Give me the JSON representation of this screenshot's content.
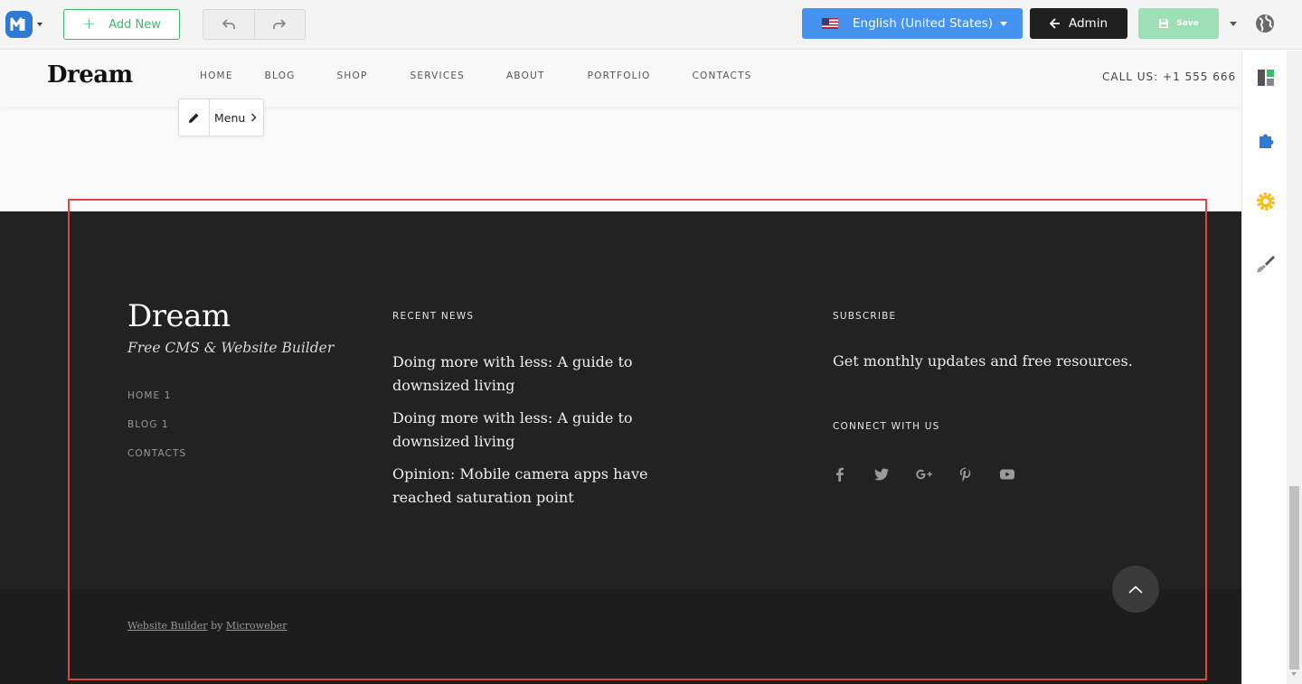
{
  "toolbar": {
    "add_new_label": "Add New",
    "language_label": "English (United States)",
    "admin_label": "Admin",
    "save_label": "Save"
  },
  "site_header": {
    "logo": "Dream",
    "nav": [
      "HOME",
      "BLOG",
      "SHOP",
      "SERVICES",
      "ABOUT",
      "PORTFOLIO",
      "CONTACTS"
    ],
    "call_us": "CALL US: +1 555 666"
  },
  "menu_popup": {
    "label": "Menu"
  },
  "footer": {
    "brand": "Dream",
    "tagline": "Free CMS & Website Builder",
    "links": [
      "HOME 1",
      "BLOG 1",
      "CONTACTS"
    ],
    "recent_news_title": "RECENT NEWS",
    "news": [
      "Doing more with less: A guide to downsized living",
      "Doing more with less: A guide to downsized living",
      "Opinion: Mobile camera apps have reached saturation point"
    ],
    "subscribe_title": "SUBSCRIBE",
    "subscribe_text": "Get monthly updates and free resources.",
    "connect_title": "CONNECT WITH US",
    "social_icons": [
      "facebook-icon",
      "twitter-icon",
      "google-plus-icon",
      "pinterest-icon",
      "youtube-icon"
    ],
    "credit_link1": "Website Builder",
    "credit_by": "by",
    "credit_link2": "Microweber"
  },
  "colors": {
    "accent_green": "#3dbb6b",
    "language_blue": "#4592f0",
    "admin_dark": "#1f1f1f",
    "save_disabled": "#9fdfb5",
    "footer_bg": "#222222",
    "selection_red": "#e2453d"
  }
}
